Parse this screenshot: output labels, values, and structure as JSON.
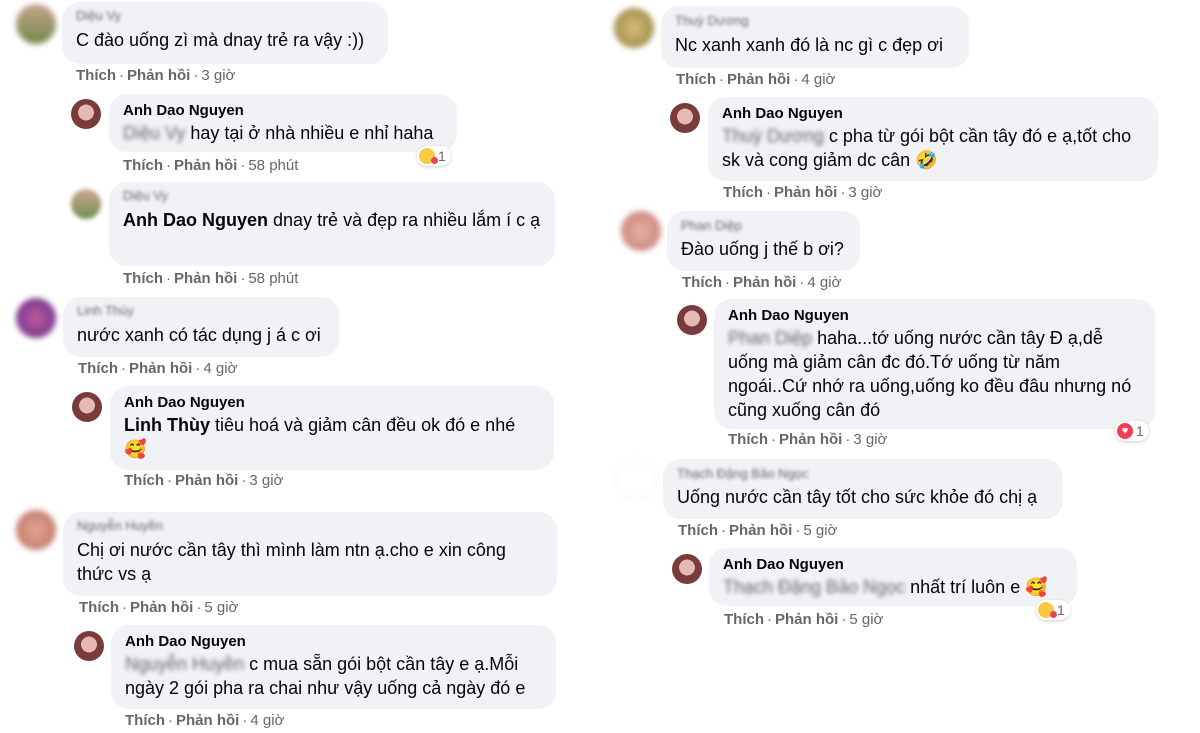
{
  "colors": {
    "bubble_bg": "#f0f2f5",
    "meta_gray": "#65676b",
    "text": "#050505"
  },
  "actions": {
    "like": "Thích",
    "reply": "Phản hồi",
    "sep": "·"
  },
  "left": [
    {
      "author": "Diệu Vy",
      "author_blurred": true,
      "text": "C đào uống zì mà dnay trẻ ra vậy :))",
      "time": "3 giờ"
    },
    {
      "author": "Anh Dao Nguyen",
      "tag": "Diệu Vy",
      "text": "hay tại ở nhà nhiều e nhỉ haha",
      "time": "58 phút",
      "reaction_icon": "care-emoji-icon",
      "reaction_count": "1"
    },
    {
      "author": "Diệu Vy",
      "author_blurred": true,
      "tag": "Anh Dao Nguyen",
      "text": "dnay trẻ và đẹp ra nhiều lắm í c ạ",
      "time": "58 phút"
    },
    {
      "author": "Linh Thùy",
      "author_blurred": true,
      "text": "nước xanh có tác dụng j á c ơi",
      "time": "4 giờ"
    },
    {
      "author": "Anh Dao Nguyen",
      "tag": "Linh Thùy",
      "text": "tiêu hoá và giảm cân đều ok đó e nhé",
      "emoji": "🥰",
      "time": "3 giờ"
    },
    {
      "author": "Nguyễn Huyền",
      "author_blurred": true,
      "text": "Chị ơi nước cần tây thì mình làm ntn ạ.cho e xin công thức vs ạ",
      "time": "5 giờ"
    },
    {
      "author": "Anh Dao Nguyen",
      "tag": "Nguyễn Huyền",
      "text": "c mua sẵn gói bột cần tây e ạ.Mỗi ngày 2 gói pha ra chai như vậy uống cả ngày đó e",
      "time": "4 giờ"
    }
  ],
  "right": [
    {
      "author": "Thuỳ Dương",
      "author_blurred": true,
      "text": "Nc xanh xanh đó là nc gì c đẹp ơi",
      "time": "4 giờ"
    },
    {
      "author": "Anh Dao Nguyen",
      "tag": "Thuỳ Dương",
      "text": "c pha từ gói bột cần tây đó e ạ,tốt cho sk và cong giảm dc cân",
      "emoji": "🤣",
      "time": "3 giờ"
    },
    {
      "author": "Phan Diệp",
      "author_blurred": true,
      "text": "Đào uống j thế b ơi?",
      "time": "4 giờ"
    },
    {
      "author": "Anh Dao Nguyen",
      "tag": "Phan Diệp",
      "text": "haha...tớ uống nước cần tây Đ ạ,dễ uống mà giảm cân đc đó.Tớ uống từ năm ngoái..Cứ nhớ ra uống,uống ko đều đâu nhưng nó cũng xuống cân đó",
      "time": "3 giờ",
      "reaction_icon": "heart-icon",
      "reaction_count": "1"
    },
    {
      "author": "Thạch Đặng Bảo Ngọc",
      "author_blurred": true,
      "text": "Uống nước cần tây tốt cho sức khỏe đó chị ạ",
      "time": "5 giờ"
    },
    {
      "author": "Anh Dao Nguyen",
      "tag": "Thạch Đặng Bảo Ngọc",
      "text": "nhất trí luôn e",
      "emoji": "🥰",
      "time": "5 giờ",
      "reaction_icon": "care-emoji-icon",
      "reaction_count": "1"
    }
  ]
}
